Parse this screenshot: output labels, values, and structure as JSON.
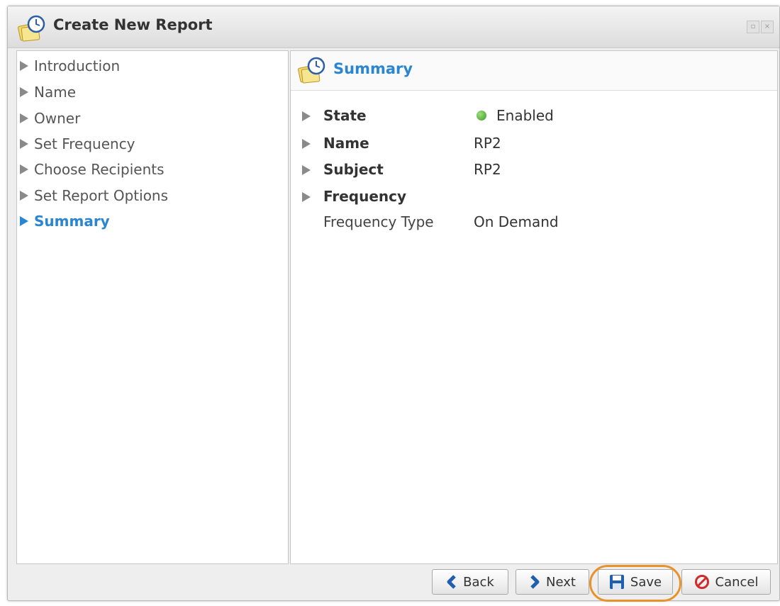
{
  "window": {
    "title": "Create New Report"
  },
  "nav": {
    "items": [
      {
        "label": "Introduction",
        "active": false
      },
      {
        "label": "Name",
        "active": false
      },
      {
        "label": "Owner",
        "active": false
      },
      {
        "label": "Set Frequency",
        "active": false
      },
      {
        "label": "Choose Recipients",
        "active": false
      },
      {
        "label": "Set Report Options",
        "active": false
      },
      {
        "label": "Summary",
        "active": true
      }
    ]
  },
  "summary": {
    "title": "Summary",
    "rows": [
      {
        "label": "State",
        "value": "Enabled",
        "status_color": "#3a9a25"
      },
      {
        "label": "Name",
        "value": "RP2"
      },
      {
        "label": "Subject",
        "value": "RP2"
      },
      {
        "label": "Frequency",
        "value": ""
      },
      {
        "label": "Frequency Type",
        "value": "On Demand"
      }
    ]
  },
  "buttons": {
    "back": "Back",
    "next": "Next",
    "save": "Save",
    "cancel": "Cancel"
  },
  "colors": {
    "accent": "#2a86d0",
    "highlight": "#e8932a",
    "cancel_icon": "#d02a2a"
  }
}
